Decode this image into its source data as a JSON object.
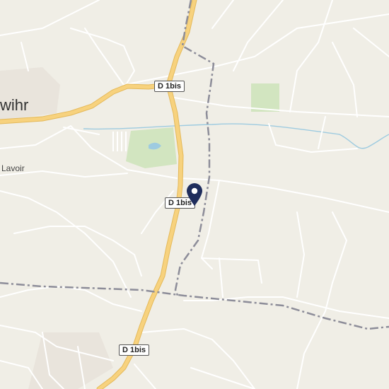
{
  "map": {
    "labels": {
      "town_partial": "wihr",
      "lavoir": "Lavoir"
    },
    "road_shields": [
      "D 1bis",
      "D 1bis",
      "D 1bis"
    ],
    "marker": {
      "icon": "map-pin-icon",
      "color": "#1f2d5c"
    },
    "colors": {
      "background": "#f0eee6",
      "minor_road": "#ffffff",
      "main_road": "#f7d27e",
      "boundary": "#8d8d99",
      "water": "#9ecbe0",
      "green": "#d2e5c0"
    }
  }
}
